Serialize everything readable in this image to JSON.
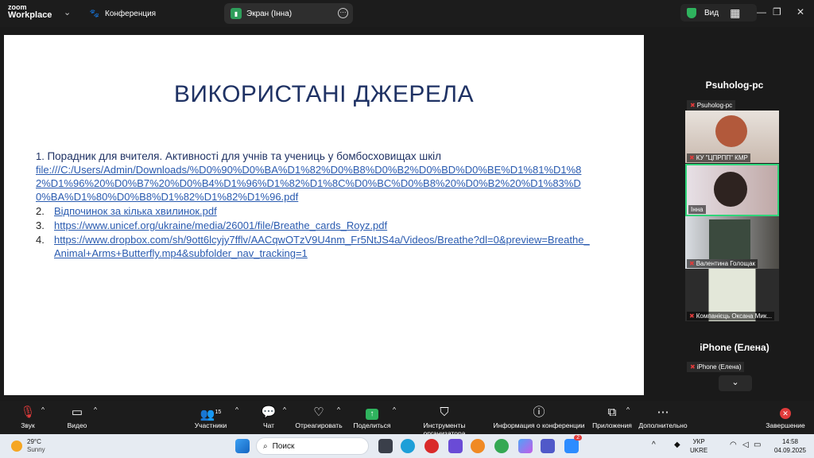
{
  "app": {
    "logo_line1": "zoom",
    "logo_line2": "Workplace"
  },
  "tabs": [
    {
      "label": "Конференция"
    },
    {
      "label": "Экран (Інна)"
    }
  ],
  "view_label": "Вид",
  "slide": {
    "title": "ВИКОРИСТАНІ ДЖЕРЕЛА",
    "item1_num": "1.",
    "item1_title": "Порадник для вчителя. Активності для учнів та учениць у бомбосховищах шкіл",
    "item1_link": "file:///C:/Users/Admin/Downloads/%D0%90%D0%BA%D1%82%D0%B8%D0%B2%D0%BD%D0%BE%D1%81%D1%82%D1%96%20%D0%B7%20%D0%B4%D1%96%D1%82%D1%8C%D0%BC%D0%B8%20%D0%B2%20%D1%83%D0%BA%D1%80%D0%B8%D1%82%D1%82%D1%96.pdf",
    "items": [
      {
        "num": "2.",
        "link": "Відпочинок за кілька хвилинок.pdf"
      },
      {
        "num": "3.",
        "link": "https://www.unicef.org/ukraine/media/26001/file/Breathe_cards_Royz.pdf"
      },
      {
        "num": "4.",
        "link": "https://www.dropbox.com/sh/9ott6lcyjy7fflv/AACqwOTzV9U4nm_Fr5NtJS4a/Videos/Breathe?dl=0&preview=Breathe_Animal+Arms+Butterfly.mp4&subfolder_nav_tracking=1"
      }
    ]
  },
  "gallery": {
    "group1": "Psuholog-pc",
    "group1_tag": "Psuholog-pc",
    "tiles": [
      {
        "label": "КУ \"ЦПРПП\" КМР"
      },
      {
        "label": "Інна"
      },
      {
        "label": "Валентина Голощак"
      },
      {
        "label": "Компанієць Оксана Мик..."
      }
    ],
    "group2": "iPhone (Елена)",
    "group2_tag": "iPhone (Елена)"
  },
  "toolbar": {
    "audio": "Звук",
    "video": "Видео",
    "participants": "Участники",
    "participants_count": "15",
    "chat": "Чат",
    "react": "Отреагировать",
    "share": "Поделиться",
    "host_tools": "Инструменты организатора",
    "info": "Информация о конференции",
    "apps": "Приложения",
    "more": "Дополнительно",
    "end": "Завершение"
  },
  "taskbar": {
    "temp": "29°C",
    "weather": "Sunny",
    "search": "Поиск",
    "lang1": "УКР",
    "lang2": "UKRE",
    "time": "14:58",
    "date": "04.09.2025",
    "badge": "2"
  }
}
